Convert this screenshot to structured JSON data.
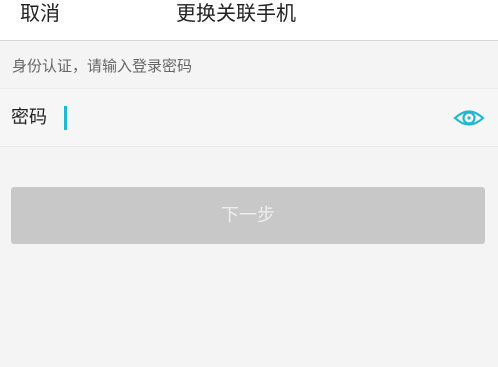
{
  "header": {
    "cancel_label": "取消",
    "title": "更换关联手机"
  },
  "hint": "身份认证，请输入登录密码",
  "password_row": {
    "label": "密码",
    "value": "",
    "toggle_icon": "eye-icon"
  },
  "next_button": {
    "label": "下一步"
  },
  "colors": {
    "accent": "#1fb8d0",
    "button_disabled": "#c8c8c8",
    "background": "#f4f4f4"
  }
}
